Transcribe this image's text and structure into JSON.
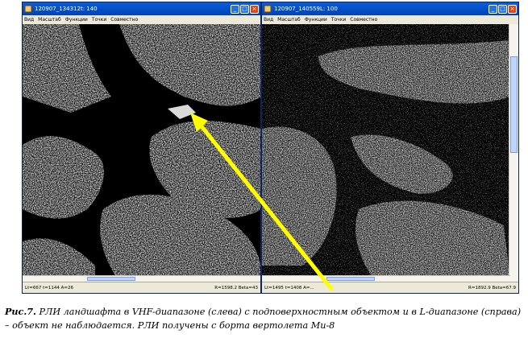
{
  "left_window": {
    "title": "120907_134312t: 140",
    "menu": [
      "Вид",
      "Масштаб",
      "Функции",
      "Точки",
      "Совместно"
    ],
    "status_left": "Lt=667 t=1144 A=26",
    "status_right": "R=1598.2 Beta=43"
  },
  "right_window": {
    "title": "120907_140559L: 100",
    "menu": [
      "Вид",
      "Масштаб",
      "Функции",
      "Точки",
      "Совместно"
    ],
    "status_left": "Lt=1495 t=1408 A=...",
    "status_right": "R=1892.9 Beta=67.9"
  },
  "caption": {
    "label": "Рис.7.",
    "text": " РЛИ ландшафта в VHF-диапазоне (слева) с подповерхностным объектом и в L-диапазоне (справа) – объект не наблюдается. РЛИ получены с борта вертолета Ми-8"
  },
  "colors": {
    "arrow": "#ffff00",
    "titlebar": "#0a5fd8"
  },
  "icons": {
    "window": "app-icon",
    "minimize": "minimize-icon",
    "maximize": "maximize-icon",
    "close": "close-icon"
  }
}
